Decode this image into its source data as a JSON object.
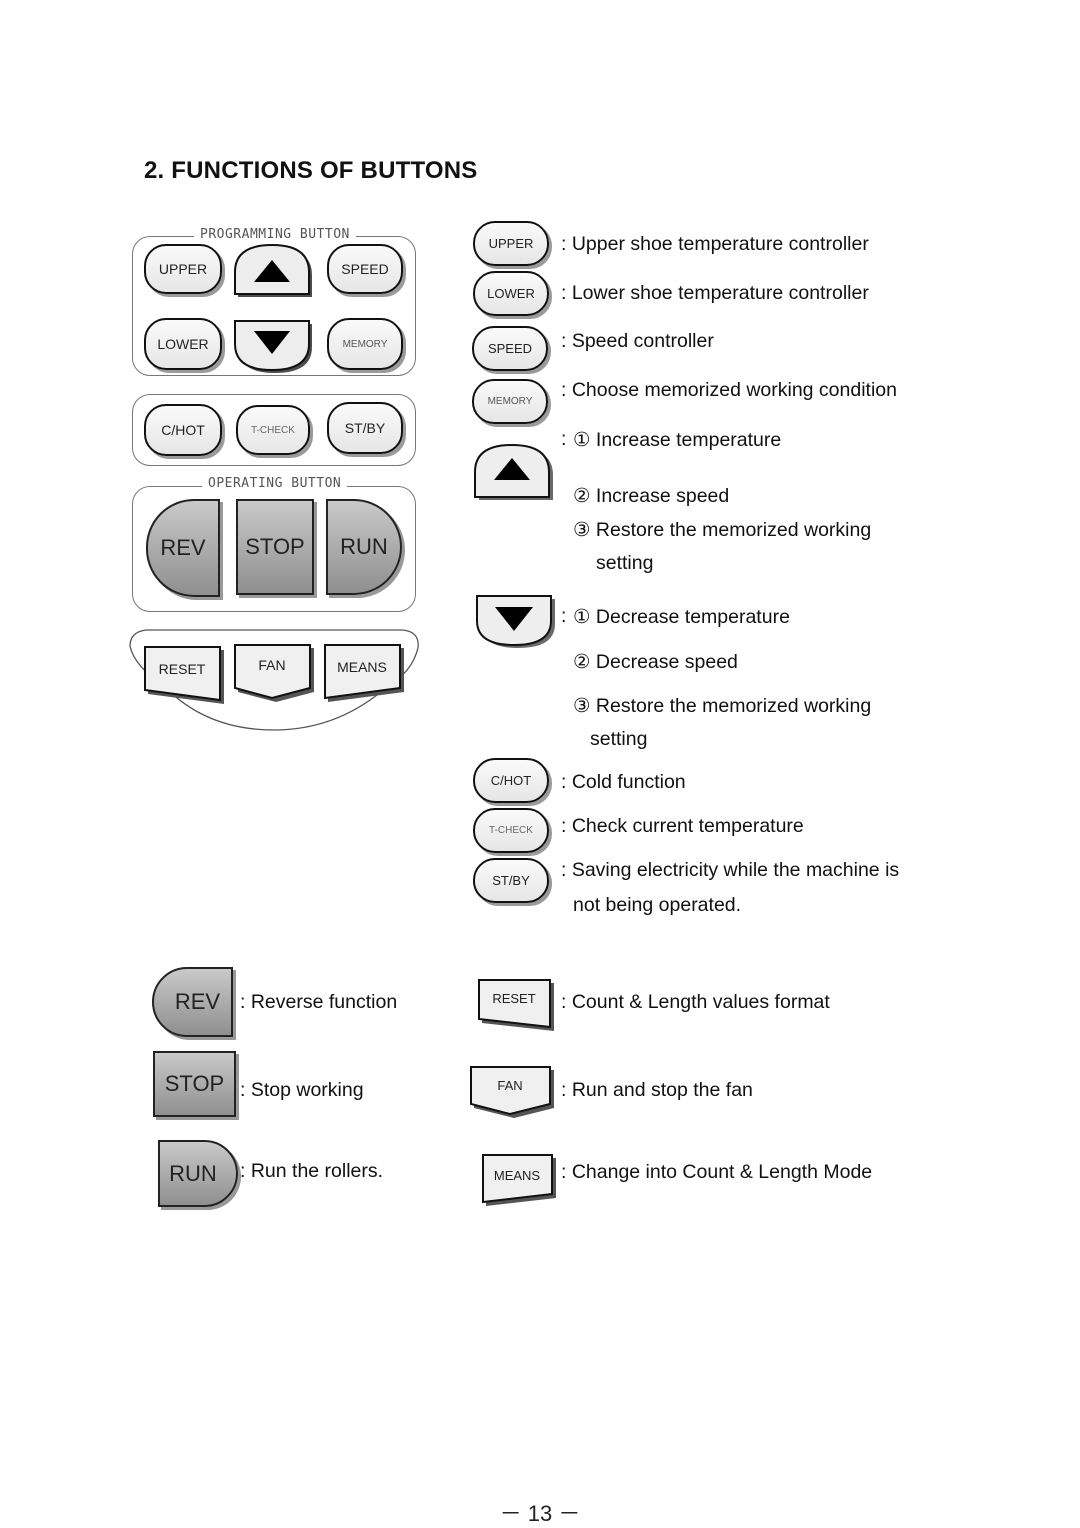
{
  "title": "2. FUNCTIONS OF BUTTONS",
  "panel": {
    "programming_label": "PROGRAMMING BUTTON",
    "operating_label": "OPERATING BUTTON",
    "buttons": {
      "upper": "UPPER",
      "speed": "SPEED",
      "lower": "LOWER",
      "memory": "MEMORY",
      "chot": "C/HOT",
      "tcheck": "T-CHECK",
      "stby": "ST/BY",
      "rev": "REV",
      "stop": "STOP",
      "run": "RUN",
      "reset": "RESET",
      "fan": "FAN",
      "means": "MEANS"
    }
  },
  "descriptions": {
    "upper": ": Upper shoe temperature controller",
    "lower": ": Lower shoe temperature controller",
    "speed": ": Speed controller",
    "memory": ": Choose memorized working condition",
    "up_colon": ":",
    "up_1": "① Increase temperature",
    "up_2": "② Increase speed",
    "up_3": "③ Restore the memorized working",
    "up_3b": "setting",
    "down_colon": ":",
    "down_1": "① Decrease temperature",
    "down_2": "② Decrease speed",
    "down_3": "③ Restore the memorized working",
    "down_3b": "setting",
    "chot": ": Cold function",
    "tcheck": ": Check current temperature",
    "stby": ": Saving electricity while the machine is",
    "stby_b": "not being operated.",
    "rev": ": Reverse function",
    "stop": ": Stop working",
    "run": ": Run the rollers.",
    "reset": ": Count & Length values format",
    "fan": ": Run and stop the fan",
    "means": ": Change into Count & Length Mode"
  },
  "page_number": "－ 13 －"
}
